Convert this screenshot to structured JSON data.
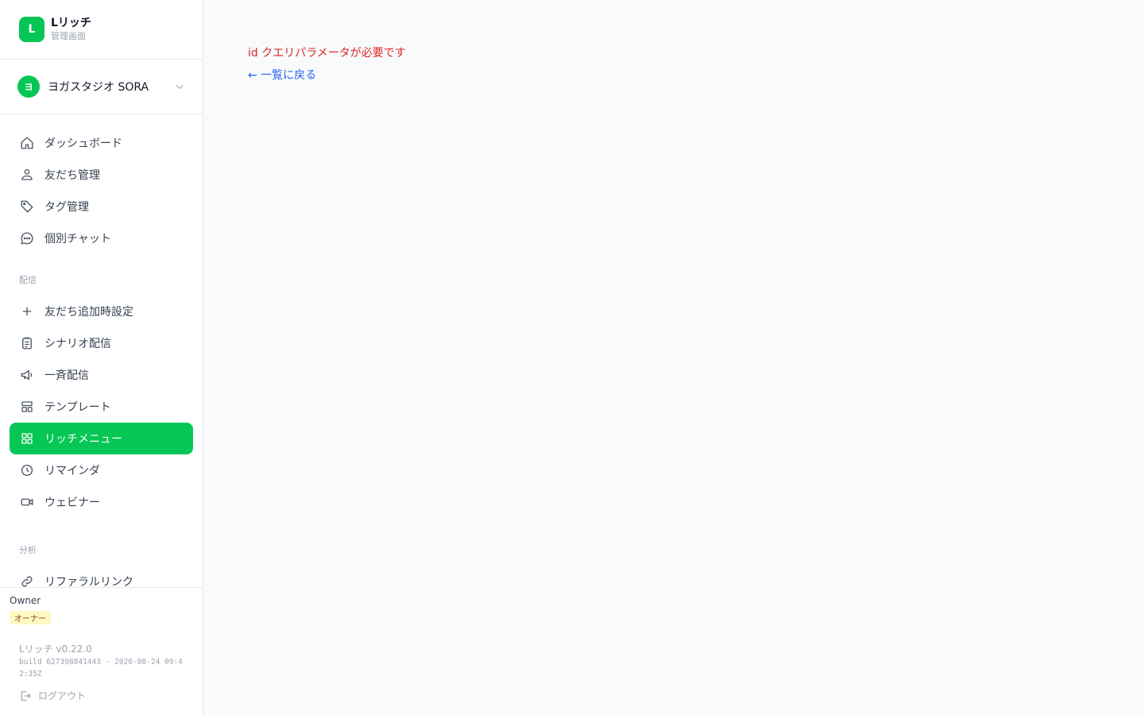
{
  "brand": {
    "logo_letter": "L",
    "name": "Lリッチ",
    "subtitle": "管理画面",
    "accent_color": "#06c755"
  },
  "account": {
    "avatar_letter": "ヨ",
    "name": "ヨガスタジオ SORA",
    "icon": "chevron-down-icon"
  },
  "nav": {
    "main": [
      {
        "label": "ダッシュボード",
        "icon": "home-icon"
      },
      {
        "label": "友だち管理",
        "icon": "users-icon"
      },
      {
        "label": "タグ管理",
        "icon": "tag-icon"
      },
      {
        "label": "個別チャット",
        "icon": "chat-icon"
      }
    ],
    "delivery_section": "配信",
    "delivery": [
      {
        "label": "友だち追加時設定",
        "icon": "plus-icon"
      },
      {
        "label": "シナリオ配信",
        "icon": "clipboard-icon"
      },
      {
        "label": "一斉配信",
        "icon": "megaphone-icon"
      },
      {
        "label": "テンプレート",
        "icon": "template-icon"
      },
      {
        "label": "リッチメニュー",
        "icon": "grid-icon",
        "active": true
      },
      {
        "label": "リマインダ",
        "icon": "clock-icon"
      },
      {
        "label": "ウェビナー",
        "icon": "video-icon"
      }
    ],
    "analytics_section": "分析",
    "analytics": [
      {
        "label": "リファラルリンク",
        "icon": "link-icon"
      }
    ]
  },
  "footer": {
    "role_name": "Owner",
    "role_badge": "オーナー",
    "version": "Lリッチ v0.22.0",
    "build": "build 627398841443 · 2026-08-24 09:42:35Z",
    "logout_label": "ログアウト",
    "logout_icon": "logout-icon"
  },
  "main": {
    "error_message": "id クエリパラメータが必要です",
    "back_link": "← 一覧に戻る"
  }
}
